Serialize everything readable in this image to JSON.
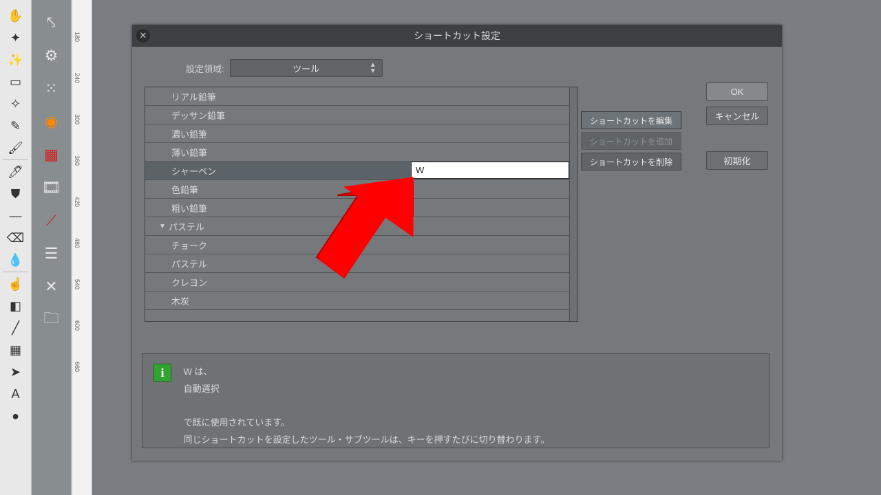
{
  "toolbar1": [
    {
      "name": "hand-tool",
      "glyph": "✋"
    },
    {
      "name": "lasso-tool",
      "glyph": "✦"
    },
    {
      "name": "magic-wand-tool",
      "glyph": "✨"
    },
    {
      "name": "marquee-tool",
      "glyph": "▭"
    },
    {
      "name": "star-tool",
      "glyph": "✧"
    },
    {
      "name": "pen-tool",
      "glyph": "✎"
    },
    {
      "name": "brush-tool",
      "glyph": "🖌"
    },
    {
      "name": "sep"
    },
    {
      "name": "brush2-tool",
      "glyph": "🖊"
    },
    {
      "name": "fill-tool",
      "glyph": "⛊"
    },
    {
      "name": "stroke-tool",
      "glyph": "―"
    },
    {
      "name": "eraser-tool",
      "glyph": "⌫"
    },
    {
      "name": "drop-tool",
      "glyph": "💧"
    },
    {
      "name": "sep"
    },
    {
      "name": "finger-tool",
      "glyph": "☝"
    },
    {
      "name": "gradient-tool",
      "glyph": "◧"
    },
    {
      "name": "line-tool",
      "glyph": "╱"
    },
    {
      "name": "grid-tool",
      "glyph": "▦"
    },
    {
      "name": "arrow2-tool",
      "glyph": "➤"
    },
    {
      "name": "text-tool",
      "glyph": "A"
    },
    {
      "name": "circle-tool",
      "glyph": "●"
    }
  ],
  "toolbar2": [
    {
      "name": "navigate-tool",
      "glyph": "⤣"
    },
    {
      "name": "settings-tool",
      "glyph": "⚙"
    },
    {
      "name": "spray-tool",
      "glyph": "⁙"
    },
    {
      "name": "color-wheel-tool",
      "glyph": "◉",
      "style": "color:#ff8800"
    },
    {
      "name": "swatches-tool",
      "glyph": "▦",
      "style": "color:#d02020"
    },
    {
      "name": "film-tool",
      "glyph": "🎞"
    },
    {
      "name": "redline-tool",
      "glyph": "⟋",
      "style": "color:#d02020"
    },
    {
      "name": "layers-tool",
      "glyph": "☰"
    },
    {
      "name": "pin-tool",
      "glyph": "✕"
    },
    {
      "name": "folder-tool",
      "glyph": "🗀"
    }
  ],
  "ruler_ticks": [
    "180",
    "240",
    "300",
    "360",
    "420",
    "480",
    "540",
    "600",
    "660"
  ],
  "dialog": {
    "title": "ショートカット設定",
    "area_label": "設定領域:",
    "area_value": "ツール",
    "ok": "OK",
    "cancel": "キャンセル",
    "reset": "初期化",
    "sc_edit": "ショートカットを編集",
    "sc_add": "ショートカットを追加",
    "sc_delete": "ショートカットを削除",
    "rows": [
      {
        "label": "リアル鉛筆"
      },
      {
        "label": "デッサン鉛筆"
      },
      {
        "label": "濃い鉛筆"
      },
      {
        "label": "薄い鉛筆"
      },
      {
        "label": "シャーペン",
        "selected": true,
        "shortcut": "W"
      },
      {
        "label": "色鉛筆"
      },
      {
        "label": "粗い鉛筆"
      },
      {
        "label": "パステル",
        "group": true
      },
      {
        "label": "チョーク"
      },
      {
        "label": "パステル"
      },
      {
        "label": "クレヨン"
      },
      {
        "label": "木炭"
      }
    ],
    "info_l1": "W は、",
    "info_l2": "自動選択",
    "info_l3": "で既に使用されています。",
    "info_l4": "同じショートカットを設定したツール・サブツールは、キーを押すたびに切り替わります。"
  }
}
